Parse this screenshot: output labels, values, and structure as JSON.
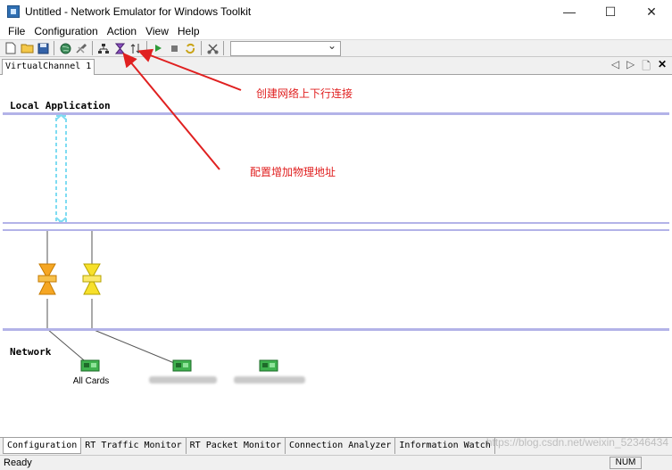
{
  "window": {
    "title": "Untitled - Network Emulator for Windows Toolkit",
    "minimize": "—",
    "maximize": "☐",
    "close": "✕"
  },
  "menu": [
    "File",
    "Configuration",
    "Action",
    "View",
    "Help"
  ],
  "toolbar": {
    "icons": [
      "new-file-icon",
      "open-folder-icon",
      "save-icon",
      "globe-icon",
      "tools-icon",
      "network-topology-icon",
      "filter-icon",
      "link-updown-icon",
      "play-icon",
      "stop-icon",
      "refresh-icon",
      "scissors-icon"
    ],
    "combo_value": ""
  },
  "channel_tab": {
    "label": "VirtualChannel 1",
    "prev": "◁",
    "next": "▷",
    "new": "🗋",
    "close": "✕"
  },
  "canvas": {
    "local_label": "Local Application",
    "network_label": "Network",
    "annotation_1": "创建网络上下行连接",
    "annotation_2": "配置增加物理地址",
    "cards": [
      {
        "name": "All Cards"
      },
      {
        "name": ""
      },
      {
        "name": ""
      }
    ],
    "colors": {
      "lane_line": "#b3b3e8",
      "annotation": "#e02020",
      "link_dash": "#7fdcf2",
      "filter_orange": "#f5a623",
      "filter_yellow": "#f7e02a"
    }
  },
  "bottom_tabs": [
    "Configuration",
    "RT Traffic Monitor",
    "RT Packet Monitor",
    "Connection Analyzer",
    "Information Watch"
  ],
  "status": {
    "text": "Ready",
    "num": "NUM"
  },
  "watermark": "https://blog.csdn.net/weixin_52346434"
}
